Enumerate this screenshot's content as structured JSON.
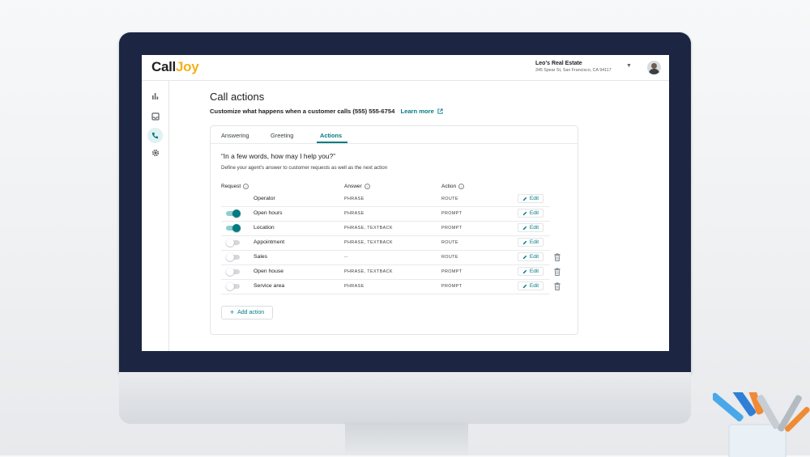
{
  "brand": {
    "logo_part1": "Call",
    "logo_part2": "Joy",
    "accent": "#f2b21b",
    "teal": "#007b83"
  },
  "business": {
    "name": "Leo's Real Estate",
    "address": "345 Spear St, San Francisco, CA 94117"
  },
  "nav": [
    "bar-chart-icon",
    "inbox-icon",
    "phone-icon",
    "gear-icon"
  ],
  "page": {
    "title": "Call actions",
    "subtitle": "Customize what happens when a customer calls (555) 555-6754",
    "learn_more": "Learn more"
  },
  "tabs": [
    {
      "label": "Answering",
      "active": false
    },
    {
      "label": "Greeting",
      "active": false
    },
    {
      "label": "Actions",
      "active": true
    }
  ],
  "actions": {
    "question": "“In a few words, how may I help you?”",
    "description": "Define your agent's answer to customer requests as well as the next action",
    "columns": {
      "request": "Request",
      "answer": "Answer",
      "action": "Action"
    },
    "edit_label": "Edit",
    "rows": [
      {
        "request": "Operator",
        "answer": "PHRASE",
        "action": "ROUTE",
        "toggle": null,
        "deletable": false
      },
      {
        "request": "Open hours",
        "answer": "PHRASE",
        "action": "PROMPT",
        "toggle": true,
        "deletable": false
      },
      {
        "request": "Location",
        "answer": "PHRASE, TEXTBACK",
        "action": "PROMPT",
        "toggle": true,
        "deletable": false
      },
      {
        "request": "Appointment",
        "answer": "PHRASE, TEXTBACK",
        "action": "ROUTE",
        "toggle": false,
        "deletable": false
      },
      {
        "request": "Sales",
        "answer": "--",
        "action": "ROUTE",
        "toggle": false,
        "deletable": true
      },
      {
        "request": "Open house",
        "answer": "PHRASE, TEXTBACK",
        "action": "PROMPT",
        "toggle": false,
        "deletable": true
      },
      {
        "request": "Service area",
        "answer": "PHRASE",
        "action": "PROMPT",
        "toggle": false,
        "deletable": true
      }
    ],
    "add_label": "Add action"
  }
}
